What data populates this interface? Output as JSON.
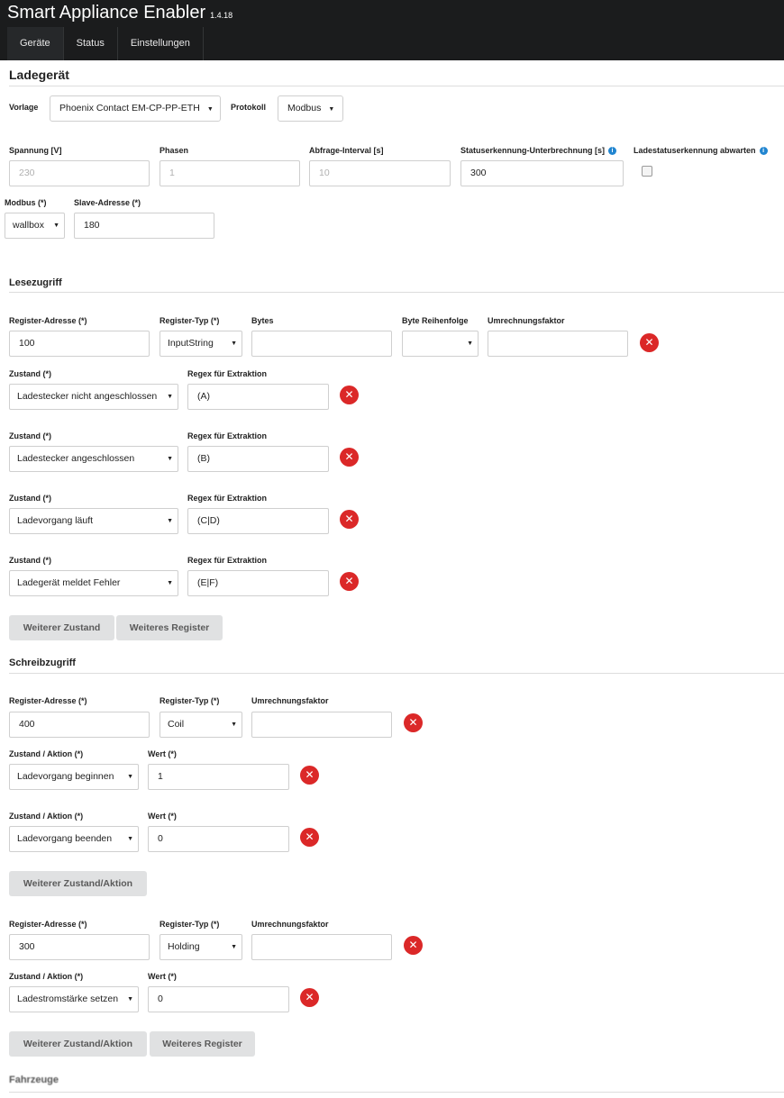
{
  "app": {
    "title": "Smart Appliance Enabler",
    "version": "1.4.18"
  },
  "nav": {
    "items": [
      "Geräte",
      "Status",
      "Einstellungen"
    ]
  },
  "page": {
    "title": "Ladegerät"
  },
  "vorlage": {
    "label": "Vorlage",
    "value": "Phoenix Contact EM-CP-PP-ETH"
  },
  "protokoll": {
    "label": "Protokoll",
    "value": "Modbus"
  },
  "fields": {
    "spannung": {
      "label": "Spannung [V]",
      "placeholder": "230"
    },
    "phasen": {
      "label": "Phasen",
      "placeholder": "1"
    },
    "abfrage": {
      "label": "Abfrage-Interval [s]",
      "placeholder": "10"
    },
    "statuserkennung": {
      "label": "Statuserkennung-Unterbrechnung [s]",
      "value": "300"
    },
    "ladestatus": {
      "label": "Ladestatuserkennung abwarten",
      "checked": false
    },
    "modbus": {
      "label": "Modbus (*)",
      "value": "wallbox"
    },
    "slave": {
      "label": "Slave-Adresse (*)",
      "value": "180"
    }
  },
  "lesezugriff": {
    "title": "Lesezugriff",
    "labels": {
      "register_adresse": "Register-Adresse (*)",
      "register_typ": "Register-Typ (*)",
      "bytes": "Bytes",
      "byte_order": "Byte Reihenfolge",
      "umrechnung": "Umrechnungsfaktor",
      "zustand": "Zustand (*)",
      "regex": "Regex für Extraktion"
    },
    "register": {
      "adresse": "100",
      "typ": "InputString",
      "bytes": "",
      "byte_order": "",
      "umrechnung": ""
    },
    "states": [
      {
        "zustand": "Ladestecker nicht angeschlossen",
        "regex": "(A)"
      },
      {
        "zustand": "Ladestecker angeschlossen",
        "regex": "(B)"
      },
      {
        "zustand": "Ladevorgang läuft",
        "regex": "(C|D)"
      },
      {
        "zustand": "Ladegerät meldet Fehler",
        "regex": "(E|F)"
      }
    ],
    "buttons": {
      "weiterer_zustand": "Weiterer Zustand",
      "weiteres_register": "Weiteres Register"
    }
  },
  "schreibzugriff": {
    "title": "Schreibzugriff",
    "labels": {
      "register_adresse": "Register-Adresse (*)",
      "register_typ": "Register-Typ (*)",
      "umrechnung": "Umrechnungsfaktor",
      "zustand_aktion": "Zustand / Aktion (*)",
      "wert": "Wert (*)"
    },
    "register1": {
      "adresse": "400",
      "typ": "Coil",
      "umrechnung": "",
      "actions": [
        {
          "aktion": "Ladevorgang beginnen",
          "wert": "1"
        },
        {
          "aktion": "Ladevorgang beenden",
          "wert": "0"
        }
      ]
    },
    "register2": {
      "adresse": "300",
      "typ": "Holding",
      "umrechnung": "",
      "actions": [
        {
          "aktion": "Ladestromstärke setzen",
          "wert": "0"
        }
      ]
    },
    "buttons": {
      "weiterer_zustand_aktion": "Weiterer Zustand/Aktion",
      "weiteres_register": "Weiteres Register"
    }
  },
  "fahrzeuge": {
    "title": "Fahrzeuge"
  },
  "icons": {
    "delete": "remove-circle-icon",
    "info": "info-circle-icon",
    "caret": "caret-down-icon"
  },
  "colors": {
    "topbar": "#1b1c1d",
    "delete": "#db2828",
    "info": "#2185d0",
    "button": "#e0e1e2"
  }
}
